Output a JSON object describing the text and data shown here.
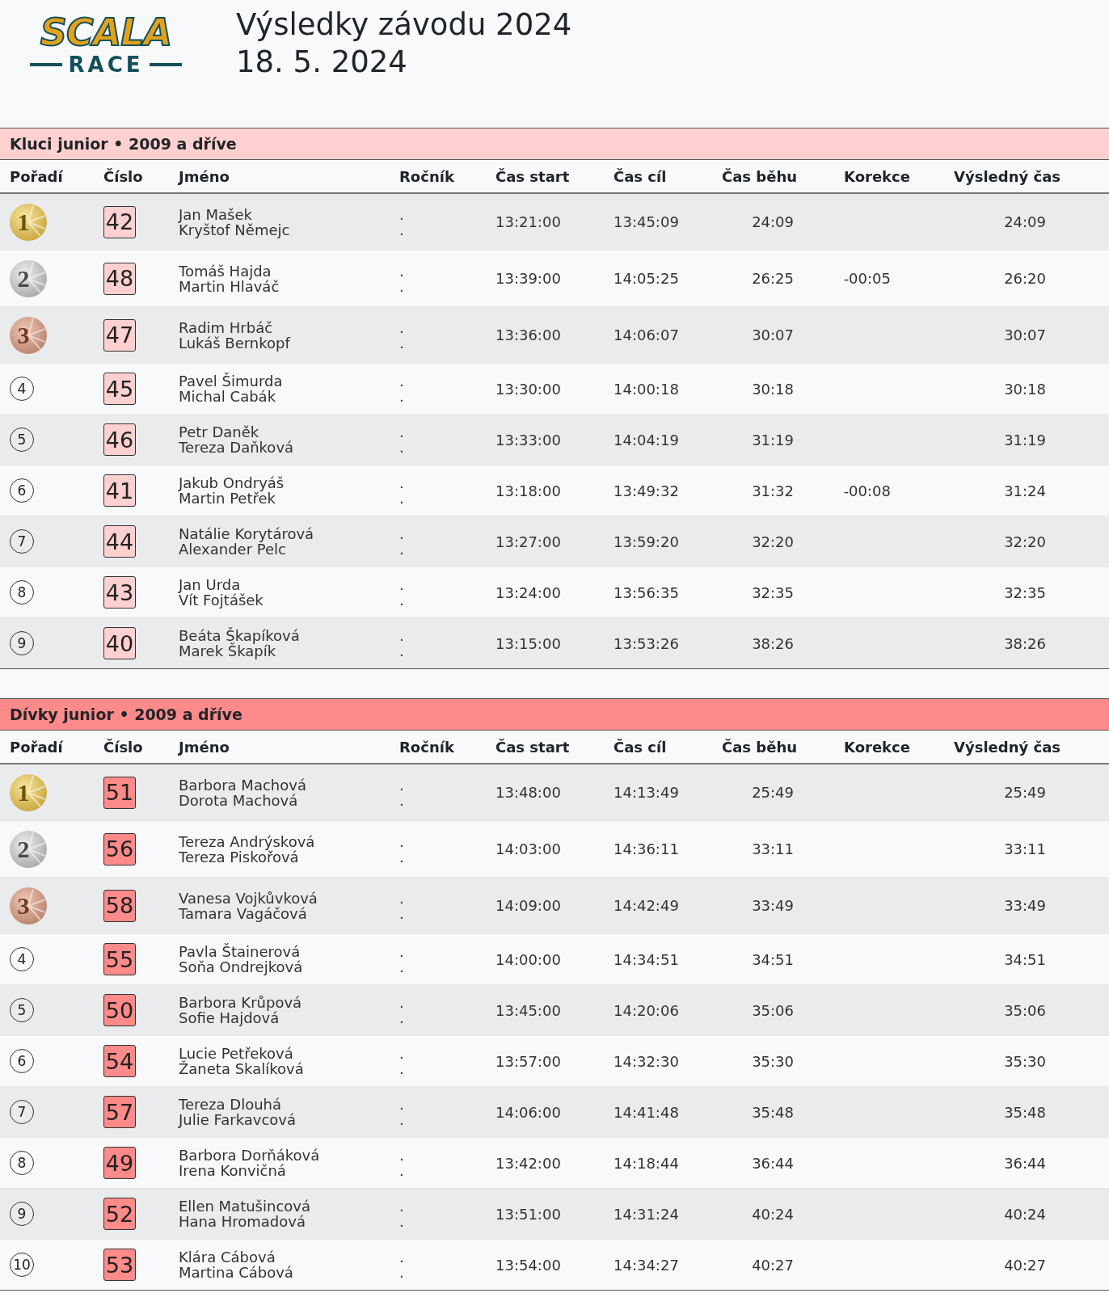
{
  "logo": {
    "word": "SCALA",
    "subword": "RACE"
  },
  "title": "Výsledky závodu 2024",
  "date": "18. 5. 2024",
  "sections": [
    {
      "title": "Kluci junior • 2009 a dříve",
      "color": "#ffd0d0",
      "columns": [
        "Pořadí",
        "Číslo",
        "Jméno",
        "Ročník",
        "Čas start",
        "Čas cíl",
        "Čas běhu",
        "Korekce",
        "Výsledný čas"
      ],
      "rows": [
        {
          "rank": "1",
          "kind": "gold",
          "number": "42",
          "members": [
            {
              "name": "Jan Mašek",
              "year": "."
            },
            {
              "name": "Kryštof Němejc",
              "year": "."
            }
          ],
          "start": "13:21:00",
          "finish": "13:45:09",
          "run": "24:09",
          "result": "24:09"
        },
        {
          "rank": "2",
          "kind": "silver",
          "number": "48",
          "members": [
            {
              "name": "Tomáš Hajda",
              "year": "."
            },
            {
              "name": "Martin Hlaváč",
              "year": "."
            }
          ],
          "start": "13:39:00",
          "finish": "14:05:25",
          "run": "26:25",
          "correction": "-00:05",
          "result": "26:20"
        },
        {
          "rank": "3",
          "kind": "bronze",
          "number": "47",
          "members": [
            {
              "name": "Radim Hrbáč",
              "year": "."
            },
            {
              "name": "Lukáš Bernkopf",
              "year": "."
            }
          ],
          "start": "13:36:00",
          "finish": "14:06:07",
          "run": "30:07",
          "result": "30:07"
        },
        {
          "rank": "4",
          "kind": "plain",
          "number": "45",
          "members": [
            {
              "name": "Pavel Šimurda",
              "year": "."
            },
            {
              "name": "Michal Cabák",
              "year": "."
            }
          ],
          "start": "13:30:00",
          "finish": "14:00:18",
          "run": "30:18",
          "result": "30:18"
        },
        {
          "rank": "5",
          "kind": "plain",
          "number": "46",
          "members": [
            {
              "name": "Petr Daněk",
              "year": "."
            },
            {
              "name": "Tereza Daňková",
              "year": "."
            }
          ],
          "start": "13:33:00",
          "finish": "14:04:19",
          "run": "31:19",
          "result": "31:19"
        },
        {
          "rank": "6",
          "kind": "plain",
          "number": "41",
          "members": [
            {
              "name": "Jakub Ondryáš",
              "year": "."
            },
            {
              "name": "Martin Petřek",
              "year": "."
            }
          ],
          "start": "13:18:00",
          "finish": "13:49:32",
          "run": "31:32",
          "correction": "-00:08",
          "result": "31:24"
        },
        {
          "rank": "7",
          "kind": "plain",
          "number": "44",
          "members": [
            {
              "name": "Natálie Korytárová",
              "year": "."
            },
            {
              "name": "Alexander Pelc",
              "year": "."
            }
          ],
          "start": "13:27:00",
          "finish": "13:59:20",
          "run": "32:20",
          "result": "32:20"
        },
        {
          "rank": "8",
          "kind": "plain",
          "number": "43",
          "members": [
            {
              "name": "Jan Urda",
              "year": "."
            },
            {
              "name": "Vít Fojtášek",
              "year": "."
            }
          ],
          "start": "13:24:00",
          "finish": "13:56:35",
          "run": "32:35",
          "result": "32:35"
        },
        {
          "rank": "9",
          "kind": "plain",
          "number": "40",
          "members": [
            {
              "name": "Beáta Škapíková",
              "year": "."
            },
            {
              "name": "Marek Škapík",
              "year": "."
            }
          ],
          "start": "13:15:00",
          "finish": "13:53:26",
          "run": "38:26",
          "result": "38:26"
        }
      ]
    },
    {
      "title": "Dívky junior • 2009 a dříve",
      "color": "#ff8a8a",
      "columns": [
        "Pořadí",
        "Číslo",
        "Jméno",
        "Ročník",
        "Čas start",
        "Čas cíl",
        "Čas běhu",
        "Korekce",
        "Výsledný čas"
      ],
      "rows": [
        {
          "rank": "1",
          "kind": "gold",
          "number": "51",
          "members": [
            {
              "name": "Barbora Machová",
              "year": "."
            },
            {
              "name": "Dorota Machová",
              "year": "."
            }
          ],
          "start": "13:48:00",
          "finish": "14:13:49",
          "run": "25:49",
          "result": "25:49"
        },
        {
          "rank": "2",
          "kind": "silver",
          "number": "56",
          "members": [
            {
              "name": "Tereza Andrýsková",
              "year": "."
            },
            {
              "name": "Tereza Piskořová",
              "year": "."
            }
          ],
          "start": "14:03:00",
          "finish": "14:36:11",
          "run": "33:11",
          "result": "33:11"
        },
        {
          "rank": "3",
          "kind": "bronze",
          "number": "58",
          "members": [
            {
              "name": "Vanesa Vojkůvková",
              "year": "."
            },
            {
              "name": "Tamara Vagáčová",
              "year": "."
            }
          ],
          "start": "14:09:00",
          "finish": "14:42:49",
          "run": "33:49",
          "result": "33:49"
        },
        {
          "rank": "4",
          "kind": "plain",
          "number": "55",
          "members": [
            {
              "name": "Pavla Štainerová",
              "year": "."
            },
            {
              "name": "Soňa Ondrejková",
              "year": "."
            }
          ],
          "start": "14:00:00",
          "finish": "14:34:51",
          "run": "34:51",
          "result": "34:51"
        },
        {
          "rank": "5",
          "kind": "plain",
          "number": "50",
          "members": [
            {
              "name": "Barbora Krůpová",
              "year": "."
            },
            {
              "name": "Sofie Hajdová",
              "year": "."
            }
          ],
          "start": "13:45:00",
          "finish": "14:20:06",
          "run": "35:06",
          "result": "35:06"
        },
        {
          "rank": "6",
          "kind": "plain",
          "number": "54",
          "members": [
            {
              "name": "Lucie Petřeková",
              "year": "."
            },
            {
              "name": "Žaneta Skalíková",
              "year": "."
            }
          ],
          "start": "13:57:00",
          "finish": "14:32:30",
          "run": "35:30",
          "result": "35:30"
        },
        {
          "rank": "7",
          "kind": "plain",
          "number": "57",
          "members": [
            {
              "name": "Tereza Dlouhá",
              "year": "."
            },
            {
              "name": "Julie Farkavcová",
              "year": "."
            }
          ],
          "start": "14:06:00",
          "finish": "14:41:48",
          "run": "35:48",
          "result": "35:48"
        },
        {
          "rank": "8",
          "kind": "plain",
          "number": "49",
          "members": [
            {
              "name": "Barbora Dorňáková",
              "year": "."
            },
            {
              "name": "Irena Konvičná",
              "year": "."
            }
          ],
          "start": "13:42:00",
          "finish": "14:18:44",
          "run": "36:44",
          "result": "36:44"
        },
        {
          "rank": "9",
          "kind": "plain",
          "number": "52",
          "members": [
            {
              "name": "Ellen Matušincová",
              "year": "."
            },
            {
              "name": "Hana Hromadová",
              "year": "."
            }
          ],
          "start": "13:51:00",
          "finish": "14:31:24",
          "run": "40:24",
          "result": "40:24"
        },
        {
          "rank": "10",
          "kind": "plain",
          "number": "53",
          "members": [
            {
              "name": "Klára Cábová",
              "year": "."
            },
            {
              "name": "Martina Cábová",
              "year": "."
            }
          ],
          "start": "13:54:00",
          "finish": "14:34:27",
          "run": "40:27",
          "result": "40:27"
        }
      ]
    }
  ]
}
